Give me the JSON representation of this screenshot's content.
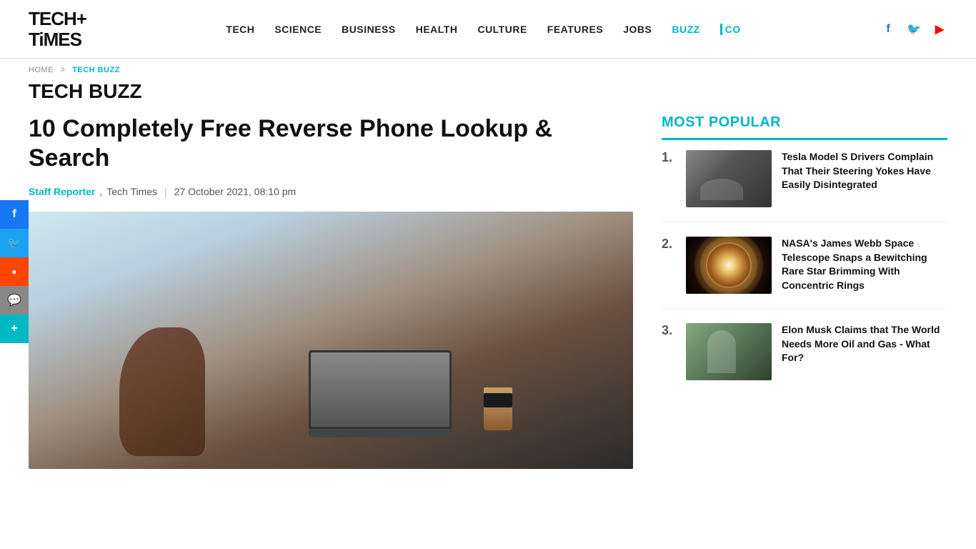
{
  "header": {
    "logo_line1": "TECH+",
    "logo_line2": "TiMES",
    "nav": {
      "items": [
        {
          "label": "TECH",
          "url": "#",
          "active": false
        },
        {
          "label": "SCIENCE",
          "url": "#",
          "active": false
        },
        {
          "label": "BUSINESS",
          "url": "#",
          "active": false
        },
        {
          "label": "HEALTH",
          "url": "#",
          "active": false
        },
        {
          "label": "CULTURE",
          "url": "#",
          "active": false
        },
        {
          "label": "FEATURES",
          "url": "#",
          "active": false
        },
        {
          "label": "JOBS",
          "url": "#",
          "active": false
        },
        {
          "label": "BUZZ",
          "url": "#",
          "active": true
        },
        {
          "label": "CO",
          "url": "#",
          "active": false
        }
      ]
    }
  },
  "breadcrumb": {
    "home": "HOME",
    "separator": ">",
    "current": "TECH BUZZ"
  },
  "page_title": "TECH BUZZ",
  "article": {
    "title": "10 Completely Free Reverse Phone Lookup & Search",
    "author": "Staff Reporter",
    "publication": "Tech Times",
    "date": "27 October 2021, 08:10 pm",
    "image_alt": "Person using phone near laptop and coffee cup"
  },
  "sidebar": {
    "most_popular_label": "MOST POPULAR",
    "items": [
      {
        "number": "1.",
        "title": "Tesla Model S Drivers Complain That Their Steering Yokes Have Easily Disintegrated",
        "thumb_type": "tesla"
      },
      {
        "number": "2.",
        "title": "NASA's James Webb Space Telescope Snaps a Bewitching Rare Star Brimming With Concentric Rings",
        "thumb_type": "nasa"
      },
      {
        "number": "3.",
        "title": "Elon Musk Claims that The World Needs More Oil and Gas - What For?",
        "thumb_type": "elon"
      }
    ]
  },
  "social_float": {
    "buttons": [
      {
        "icon": "f",
        "label": "Facebook",
        "class": "sfb-facebook"
      },
      {
        "icon": "🐦",
        "label": "Twitter",
        "class": "sfb-twitter"
      },
      {
        "icon": "●",
        "label": "Reddit",
        "class": "sfb-reddit"
      },
      {
        "icon": "💬",
        "label": "Chat",
        "class": "sfb-chat"
      },
      {
        "icon": "+",
        "label": "More",
        "class": "sfb-plus"
      }
    ]
  }
}
